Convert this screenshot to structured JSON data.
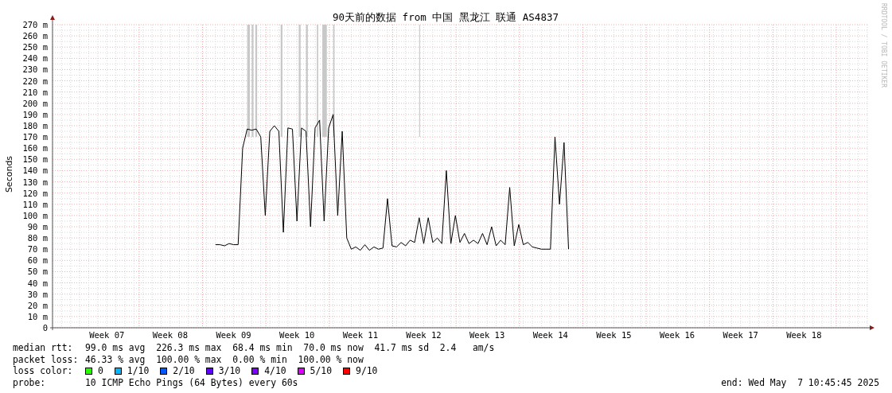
{
  "graph": {
    "title": "90天前的数据 from 中国 黑龙江 联通 AS4837",
    "credit": "RRDTOOL / TOBI OETIKER",
    "chart_data": {
      "type": "line",
      "ylabel": "Seconds",
      "ylim": [
        0,
        270
      ],
      "grid": true,
      "yticks": [
        {
          "value": 0,
          "label": "0"
        },
        {
          "value": 10,
          "label": "10 m"
        },
        {
          "value": 20,
          "label": "20 m"
        },
        {
          "value": 30,
          "label": "30 m"
        },
        {
          "value": 40,
          "label": "40 m"
        },
        {
          "value": 50,
          "label": "50 m"
        },
        {
          "value": 60,
          "label": "60 m"
        },
        {
          "value": 70,
          "label": "70 m"
        },
        {
          "value": 80,
          "label": "80 m"
        },
        {
          "value": 90,
          "label": "90 m"
        },
        {
          "value": 100,
          "label": "100 m"
        },
        {
          "value": 110,
          "label": "110 m"
        },
        {
          "value": 120,
          "label": "120 m"
        },
        {
          "value": 130,
          "label": "130 m"
        },
        {
          "value": 140,
          "label": "140 m"
        },
        {
          "value": 150,
          "label": "150 m"
        },
        {
          "value": 160,
          "label": "160 m"
        },
        {
          "value": 170,
          "label": "170 m"
        },
        {
          "value": 180,
          "label": "180 m"
        },
        {
          "value": 190,
          "label": "190 m"
        },
        {
          "value": 200,
          "label": "200 m"
        },
        {
          "value": 210,
          "label": "210 m"
        },
        {
          "value": 220,
          "label": "220 m"
        },
        {
          "value": 230,
          "label": "230 m"
        },
        {
          "value": 240,
          "label": "240 m"
        },
        {
          "value": 250,
          "label": "250 m"
        },
        {
          "value": 260,
          "label": "260 m"
        },
        {
          "value": 270,
          "label": "270 m"
        }
      ],
      "categories": [
        null,
        null,
        null,
        null,
        null,
        null,
        null,
        null,
        null,
        null,
        null,
        null,
        "Week 07",
        null,
        null,
        null,
        null,
        null,
        null,
        null,
        null,
        null,
        null,
        null,
        null,
        null,
        "Week 08",
        null,
        null,
        null,
        null,
        null,
        null,
        null,
        null,
        null,
        null,
        null,
        null,
        null,
        "Week 09",
        null,
        null,
        null,
        null,
        null,
        null,
        null,
        null,
        null,
        null,
        null,
        null,
        null,
        "Week 10",
        null,
        null,
        null,
        null,
        null,
        null,
        null,
        null,
        null,
        null,
        null,
        null,
        null,
        "Week 11",
        null,
        null,
        null,
        null,
        null,
        null,
        null,
        null,
        null,
        null,
        null,
        null,
        null,
        "Week 12",
        null,
        null,
        null,
        null,
        null,
        null,
        null,
        null,
        null,
        null,
        null,
        null,
        null,
        "Week 13",
        null,
        null,
        null,
        null,
        null,
        null,
        null,
        null,
        null,
        null,
        null,
        null,
        null,
        "Week 14",
        null,
        null,
        null,
        null,
        null,
        null,
        null,
        null,
        null,
        null,
        null,
        null,
        null,
        "Week 15",
        null,
        null,
        null,
        null,
        null,
        null,
        null,
        null,
        null,
        null,
        null,
        null,
        null,
        "Week 16",
        null,
        null,
        null,
        null,
        null,
        null,
        null,
        null,
        null,
        null,
        null,
        null,
        null,
        "Week 17",
        null,
        null,
        null,
        null,
        null,
        null,
        null,
        null,
        null,
        null,
        null,
        null,
        null,
        "Week 18",
        null,
        null,
        null,
        null,
        null,
        null,
        null,
        null,
        null,
        null,
        null,
        null,
        null,
        null
      ],
      "series": [
        {
          "color": "#000000",
          "values": [
            null,
            null,
            null,
            null,
            null,
            null,
            null,
            null,
            null,
            null,
            null,
            null,
            null,
            null,
            null,
            null,
            null,
            null,
            null,
            null,
            null,
            null,
            null,
            null,
            null,
            null,
            null,
            null,
            null,
            null,
            null,
            null,
            null,
            null,
            null,
            null,
            74,
            74,
            73,
            75,
            74,
            74,
            160,
            177,
            176,
            177,
            170,
            100,
            175,
            180,
            175,
            85,
            178,
            177,
            95,
            178,
            175,
            90,
            178,
            185,
            95,
            178,
            190,
            100,
            175,
            80,
            70,
            72,
            69,
            74,
            69,
            72,
            70,
            71,
            115,
            73,
            72,
            76,
            73,
            78,
            76,
            98,
            75,
            98,
            76,
            80,
            75,
            140,
            75,
            100,
            76,
            84,
            75,
            78,
            75,
            84,
            74,
            90,
            73,
            78,
            74,
            125,
            73,
            92,
            74,
            76,
            72,
            71,
            70,
            70,
            70,
            170,
            110,
            165,
            70,
            null,
            null,
            null,
            null,
            null,
            null,
            null,
            null,
            null,
            null,
            null,
            null,
            null,
            null,
            null,
            null,
            null,
            null,
            null,
            null,
            null,
            null,
            null,
            null,
            null,
            null,
            null,
            null,
            null,
            null,
            null,
            null,
            null,
            null,
            null,
            null,
            null,
            null,
            null,
            null,
            null,
            null,
            null,
            null,
            null,
            null,
            null,
            null,
            null,
            null,
            null,
            null,
            null,
            null,
            null,
            null,
            null,
            null,
            null,
            null,
            null,
            null,
            null,
            null,
            null,
            null
          ]
        }
      ]
    }
  },
  "legend": {
    "rows": [
      {
        "label": "median rtt:",
        "value": "99.0 ms avg  226.3 ms max  68.4 ms min  70.0 ms now  41.7 ms sd  2.4   am/s"
      },
      {
        "label": "packet loss:",
        "value": "46.33 % avg  100.00 % max  0.00 % min  100.00 % now"
      }
    ],
    "loss_label": "loss color:",
    "loss_colors": [
      {
        "label": "0",
        "color": "#26ff00"
      },
      {
        "label": "1/10",
        "color": "#00b8ff"
      },
      {
        "label": "2/10",
        "color": "#0059ff"
      },
      {
        "label": "3/10",
        "color": "#5e00ff"
      },
      {
        "label": "4/10",
        "color": "#7e00ff"
      },
      {
        "label": "5/10",
        "color": "#dd00ff"
      },
      {
        "label": "9/10",
        "color": "#ff0000"
      }
    ],
    "probe_label": "probe:",
    "probe": "10 ICMP Echo Pings (64 Bytes) every 60s",
    "end": "end: Wed May  7 10:45:45 2025"
  }
}
